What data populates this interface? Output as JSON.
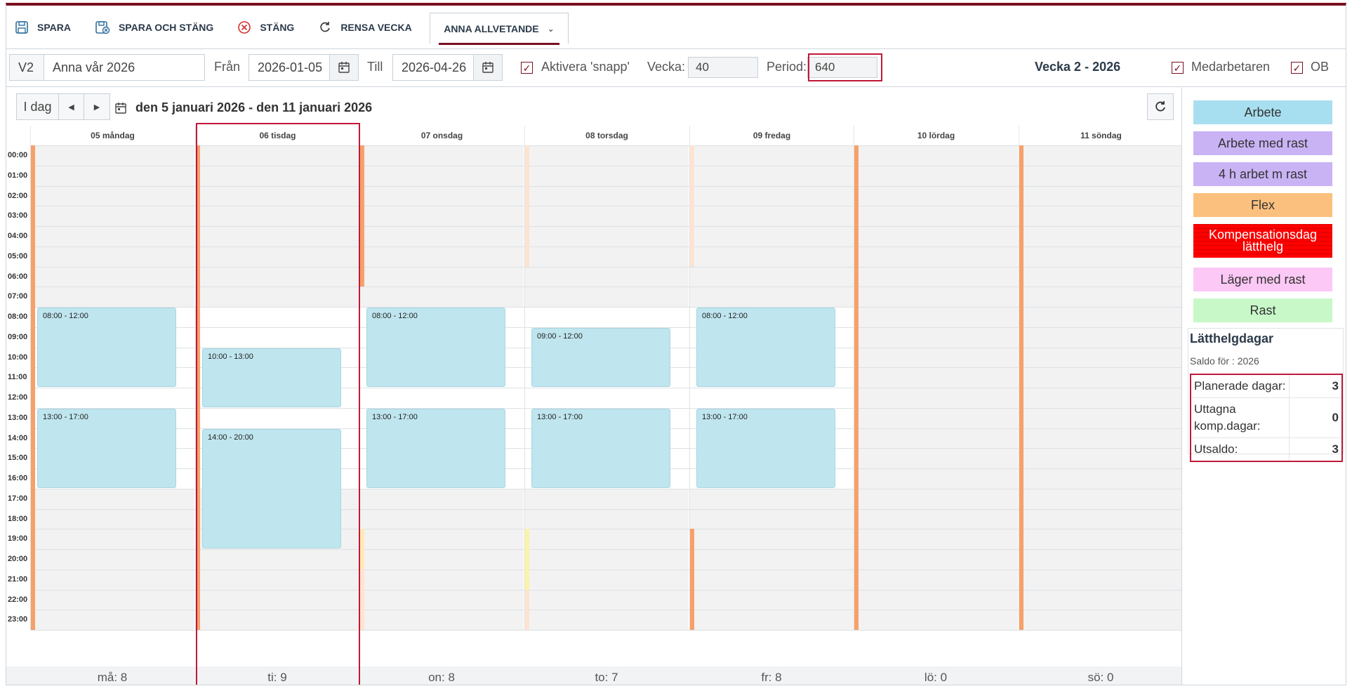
{
  "toolbar": {
    "save": "SPARA",
    "save_close": "SPARA OCH STÄNG",
    "close": "STÄNG",
    "clear_week": "RENSA VECKA",
    "user": "ANNA ALLVETANDE"
  },
  "filters": {
    "version": "V2",
    "schedule_name": "Anna vår 2026",
    "from_label": "Från",
    "from_date": "2026-01-05",
    "to_label": "Till",
    "to_date": "2026-04-26",
    "snap_label": "Aktivera 'snapp'",
    "snap_checked": true,
    "week_label": "Vecka:",
    "week_value": "40",
    "period_label": "Period:",
    "period_value": "640",
    "week_title": "Vecka 2 - 2026",
    "employee_label": "Medarbetaren",
    "employee_checked": true,
    "ob_label": "OB",
    "ob_checked": true
  },
  "calendar": {
    "today_label": "I dag",
    "range_text": "den 5 januari 2026 - den 11 januari 2026",
    "hours": [
      "00:00",
      "01:00",
      "02:00",
      "03:00",
      "04:00",
      "05:00",
      "06:00",
      "07:00",
      "08:00",
      "09:00",
      "10:00",
      "11:00",
      "12:00",
      "13:00",
      "14:00",
      "15:00",
      "16:00",
      "17:00",
      "18:00",
      "19:00",
      "20:00",
      "21:00",
      "22:00",
      "23:00"
    ],
    "days": [
      {
        "label": "05 måndag",
        "footer": "må: 8",
        "events": [
          {
            "start": 8,
            "end": 12,
            "text": "08:00 - 12:00"
          },
          {
            "start": 13,
            "end": 17,
            "text": "13:00 - 17:00"
          }
        ]
      },
      {
        "label": "06 tisdag",
        "footer": "ti: 9",
        "events": [
          {
            "start": 10,
            "end": 13,
            "text": "10:00 - 13:00"
          },
          {
            "start": 14,
            "end": 20,
            "text": "14:00 - 20:00"
          }
        ]
      },
      {
        "label": "07 onsdag",
        "footer": "on: 8",
        "events": [
          {
            "start": 8,
            "end": 12,
            "text": "08:00 - 12:00"
          },
          {
            "start": 13,
            "end": 17,
            "text": "13:00 - 17:00"
          }
        ]
      },
      {
        "label": "08 torsdag",
        "footer": "to: 7",
        "events": [
          {
            "start": 9,
            "end": 12,
            "text": "09:00 - 12:00"
          },
          {
            "start": 13,
            "end": 17,
            "text": "13:00 - 17:00"
          }
        ]
      },
      {
        "label": "09 fredag",
        "footer": "fr: 8",
        "events": [
          {
            "start": 8,
            "end": 12,
            "text": "08:00 - 12:00"
          },
          {
            "start": 13,
            "end": 17,
            "text": "13:00 - 17:00"
          }
        ]
      },
      {
        "label": "10 lördag",
        "footer": "lö: 0",
        "events": []
      },
      {
        "label": "11 söndag",
        "footer": "sö: 0",
        "events": []
      }
    ]
  },
  "legend": [
    {
      "label": "Arbete",
      "color": "#a8dff0"
    },
    {
      "label": "Arbete med rast",
      "color": "#c9b3f5"
    },
    {
      "label": "4 h arbet m rast",
      "color": "#c9b3f5"
    },
    {
      "label": "Flex",
      "color": "#fcc07e"
    },
    {
      "label": "Kompensationsdag lätthelg",
      "color": "#ff0000"
    },
    {
      "label": "Läger med rast",
      "color": "#fcc8f5"
    },
    {
      "label": "Rast",
      "color": "#c8f8c8"
    }
  ],
  "latthelg": {
    "title": "Lätthelgdagar",
    "subtitle": "Saldo för : 2026",
    "rows": [
      {
        "label": "Planerade dagar:",
        "value": "3"
      },
      {
        "label": "Uttagna komp.dagar:",
        "value": "0"
      },
      {
        "label": "Utsaldo:",
        "value": "3"
      }
    ]
  }
}
